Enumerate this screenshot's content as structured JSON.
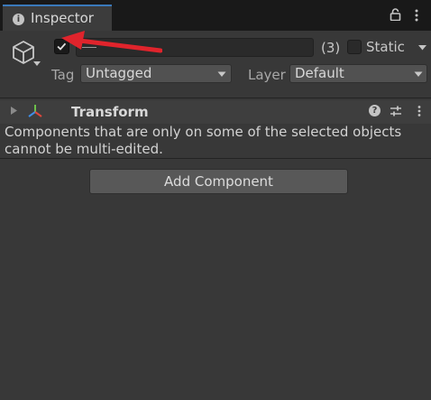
{
  "tab": {
    "title": "Inspector",
    "info_icon": "i",
    "lock_icon": "lock-icon",
    "menu_icon": "kebab-menu-icon"
  },
  "header": {
    "object_icon": "gameobject-cube-icon",
    "active_checked": true,
    "name_value": "—",
    "selected_count": "(3)",
    "static_label": "Static",
    "static_checked": false,
    "tag_label": "Tag",
    "tag_value": "Untagged",
    "layer_label": "Layer",
    "layer_value": "Default"
  },
  "transform": {
    "title": "Transform",
    "help_icon": "?",
    "presets_icon": "presets-sliders-icon",
    "menu_icon": "kebab-menu-icon"
  },
  "message": "Components that are only on some of the selected objects cannot be multi-edited.",
  "add_component_label": "Add Component",
  "colors": {
    "accent": "#3a79bb",
    "background": "#383838",
    "annotation_arrow": "#e0242c"
  }
}
